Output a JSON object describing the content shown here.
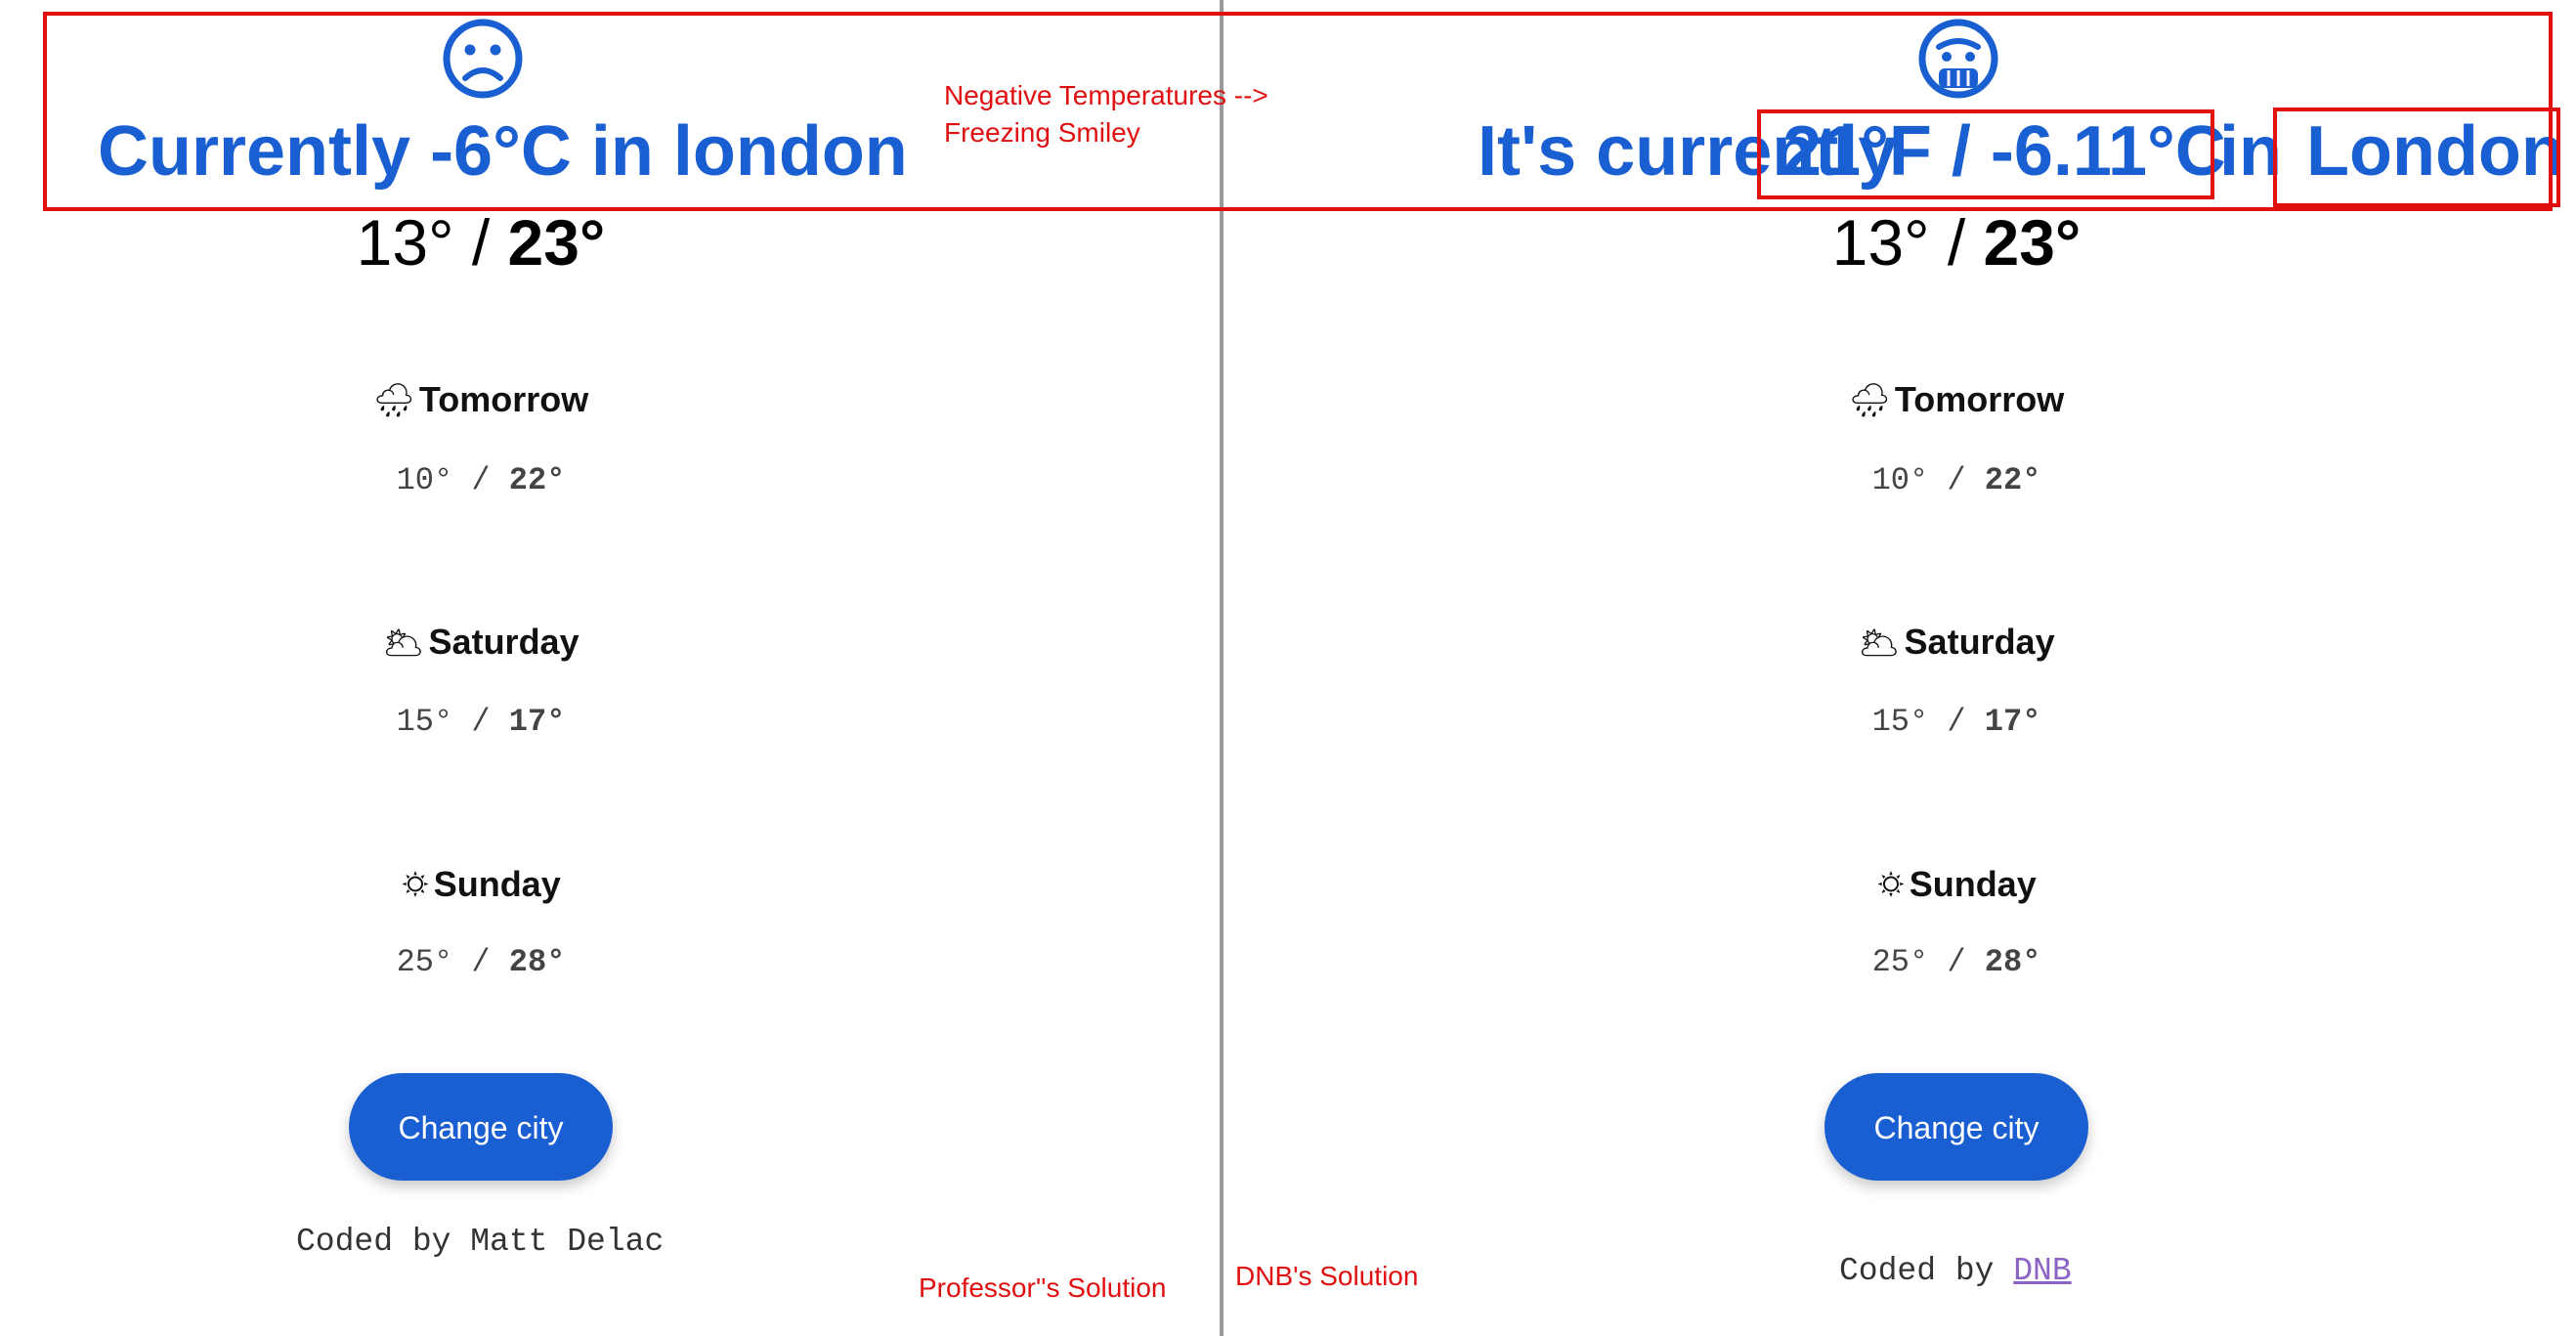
{
  "panels": {
    "left": {
      "headline": "Currently -6°C in london",
      "today": {
        "low": "13°",
        "sep": " / ",
        "high": "23°"
      },
      "forecast": [
        {
          "icon": "🌧",
          "day": "Tomorrow",
          "low": "10°",
          "sep": " / ",
          "high": "22°"
        },
        {
          "icon": "🌥",
          "day": "Saturday",
          "low": "15°",
          "sep": " / ",
          "high": "17°"
        },
        {
          "icon": "🌣",
          "day": "Sunday",
          "low": "25°",
          "sep": " / ",
          "high": "28°"
        }
      ],
      "button_label": "Change city",
      "footer": {
        "text": "Coded by Matt Delac"
      },
      "smiley_icon": "frowning-face-icon"
    },
    "right": {
      "headline_prefix": "It's currently",
      "headline_temp": "21°F / -6.11°C",
      "headline_in": "in",
      "headline_city": "London",
      "today": {
        "low": "13°",
        "sep": " / ",
        "high": "23°"
      },
      "forecast": [
        {
          "icon": "🌧",
          "day": "Tomorrow",
          "low": "10°",
          "sep": " / ",
          "high": "22°"
        },
        {
          "icon": "🌥",
          "day": "Saturday",
          "low": "15°",
          "sep": " / ",
          "high": "17°"
        },
        {
          "icon": "🌣",
          "day": "Sunday",
          "low": "25°",
          "sep": " / ",
          "high": "28°"
        }
      ],
      "button_label": "Change city",
      "footer": {
        "prefix": "Coded by ",
        "link": "DNB"
      },
      "smiley_icon": "freezing-face-icon"
    }
  },
  "annotations": {
    "note_line1": "Negative Temperatures -->",
    "note_line2": "Freezing Smiley",
    "left_caption": "Professor''s Solution",
    "right_caption": "DNB's Solution"
  },
  "colors": {
    "accent": "#1a5fd1",
    "annotation": "#e01010",
    "link": "#8a63c4"
  }
}
